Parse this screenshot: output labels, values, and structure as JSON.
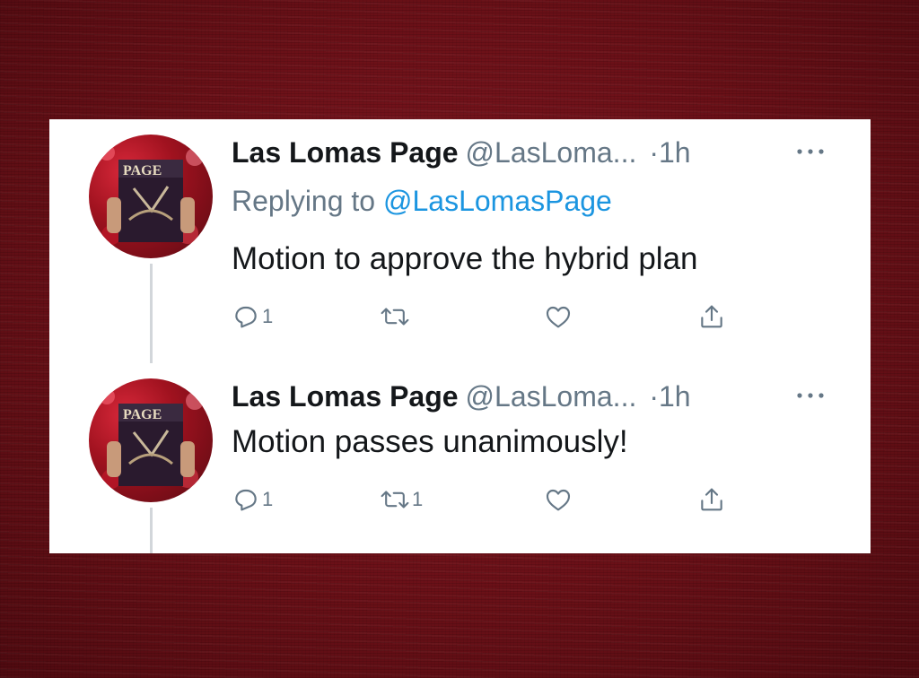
{
  "colors": {
    "background": "#6e1219",
    "card": "#ffffff",
    "text": "#14171a",
    "muted": "#657786",
    "link": "#1b95e0"
  },
  "tweets": [
    {
      "display_name": "Las Lomas Page",
      "handle": "@LasLoma...",
      "separator": "·",
      "time": "1h",
      "replying_label": "Replying to",
      "replying_to": "@LasLomasPage",
      "text": "Motion to approve the hybrid plan",
      "reply_count": "1",
      "retweet_count": "",
      "icons": {
        "more": "more-icon",
        "reply": "reply-icon",
        "retweet": "retweet-icon",
        "like": "like-icon",
        "share": "share-icon"
      }
    },
    {
      "display_name": "Las Lomas Page",
      "handle": "@LasLoma...",
      "separator": "·",
      "time": "1h",
      "text": "Motion passes unanimously!",
      "reply_count": "1",
      "retweet_count": "1",
      "icons": {
        "more": "more-icon",
        "reply": "reply-icon",
        "retweet": "retweet-icon",
        "like": "like-icon",
        "share": "share-icon"
      }
    }
  ],
  "avatar_logo": "PAGE"
}
